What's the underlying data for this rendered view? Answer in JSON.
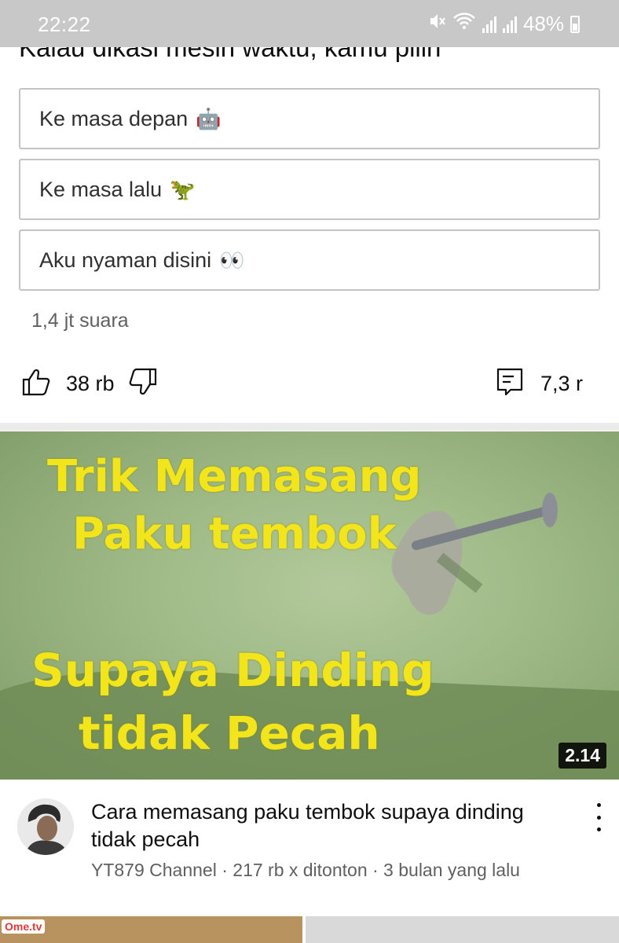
{
  "status_bar": {
    "time": "22:22",
    "battery": "48%"
  },
  "poll": {
    "question": "Kalau dikasi mesin waktu, kamu pilih",
    "options": [
      {
        "label": "Ke masa depan",
        "emoji": "🤖"
      },
      {
        "label": "Ke masa lalu",
        "emoji": "🦖"
      },
      {
        "label": "Aku nyaman disini",
        "emoji": "👀"
      }
    ],
    "votes": "1,4 jt suara"
  },
  "actions": {
    "likes": "38 rb",
    "comments": "7,3 r"
  },
  "video": {
    "thumbnail_lines": [
      "Trik Memasang",
      "Paku tembok",
      "Supaya Dinding",
      "tidak Pecah"
    ],
    "duration": "2.14",
    "title": "Cara memasang paku tembok supaya dinding tidak pecah",
    "subtitle": "YT879 Channel · 217 rb x ditonton · 3 bulan yang lalu"
  },
  "next_video": {
    "watermark": "Ome.tv"
  },
  "colors": {
    "thumb_text": "#f2e51c",
    "thumb_bg": "#9db885",
    "border": "#c4c4c4",
    "meta": "#606060"
  },
  "icons": [
    "mute-icon",
    "wifi-icon",
    "signal-icon",
    "battery-icon",
    "like-icon",
    "dislike-icon",
    "comment-icon",
    "more-vert-icon"
  ]
}
